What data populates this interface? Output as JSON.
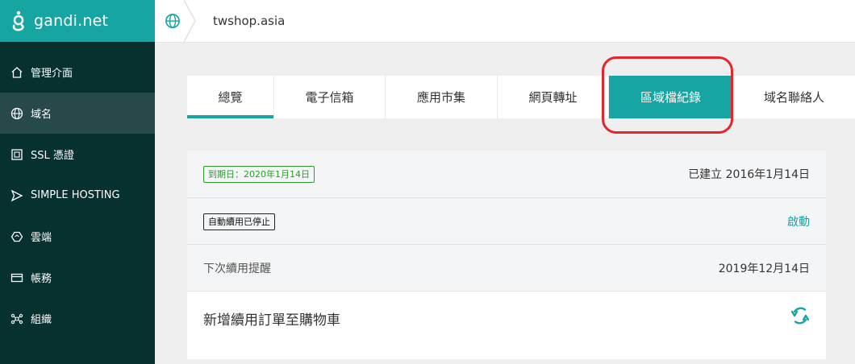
{
  "app": {
    "logo_text": "gandi.net",
    "brand_color": "#17a5a4"
  },
  "sidebar": {
    "items": [
      {
        "label": "管理介面",
        "icon": "home-icon"
      },
      {
        "label": "域名",
        "icon": "globe-icon",
        "active": true
      },
      {
        "label": "SSL 憑證",
        "icon": "certificate-icon"
      },
      {
        "label": "SIMPLE HOSTING",
        "icon": "send-icon"
      },
      {
        "label": "雲端",
        "icon": "cloud-hexagon-icon"
      },
      {
        "label": "帳務",
        "icon": "credit-card-icon"
      },
      {
        "label": "組織",
        "icon": "organization-icon"
      }
    ]
  },
  "header": {
    "domain": "twshop.asia",
    "icon": "globe-icon"
  },
  "tabs": [
    {
      "label": "總覽",
      "state": "underlined"
    },
    {
      "label": "電子信箱"
    },
    {
      "label": "應用市集"
    },
    {
      "label": "網頁轉址"
    },
    {
      "label": "區域檔紀錄",
      "state": "selected"
    },
    {
      "label": "域名聯絡人"
    }
  ],
  "info": {
    "expiry_badge": "到期日：2020年1月14日",
    "created": "已建立 2016年1月14日",
    "autorenew_badge": "自動續用已停止",
    "autorenew_action": "啟動",
    "reminder_label": "下次續用提醒",
    "reminder_date": "2019年12月14日",
    "add_renewal_label": "新增續用訂單至購物車"
  }
}
